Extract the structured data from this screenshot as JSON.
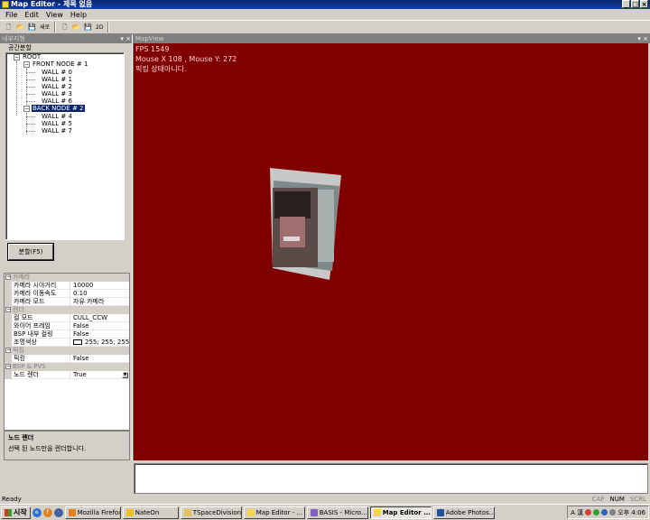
{
  "window": {
    "title": "Map Editor - 제목 없음",
    "controls": [
      "_",
      "□",
      "×"
    ]
  },
  "menu": [
    "File",
    "Edit",
    "View",
    "Help"
  ],
  "toolbar": {
    "label_a": "새로",
    "label_b": "2D"
  },
  "left_panel": {
    "title": "내부지형",
    "group_label": "공간분할",
    "tree": {
      "root": "ROOT",
      "front": "FRONT NODE # 1",
      "front_walls": [
        "WALL # 0",
        "WALL # 1",
        "WALL # 2",
        "WALL # 3",
        "WALL # 6"
      ],
      "back": "BACK NODE # 2",
      "back_walls": [
        "WALL # 4",
        "WALL # 5",
        "WALL # 7"
      ]
    },
    "split_button": "분할(F5)"
  },
  "properties": {
    "cat_camera": "카메라",
    "cam_far_k": "카메라 시야거리",
    "cam_far_v": "10000",
    "cam_speed_k": "카메라 이동속도",
    "cam_speed_v": "0.10",
    "cam_mode_k": "카메라 모드",
    "cam_mode_v": "자유 카메라",
    "cat_render": "렌더",
    "cull_k": "컬 모드",
    "cull_v": "CULL_CCW",
    "wire_k": "와이어 프레임",
    "wire_v": "False",
    "bspcull_k": "BSP 내부 컬링",
    "bspcull_v": "False",
    "light_k": "조명색상",
    "light_v": "255; 255; 255",
    "cat_pick": "픽킹",
    "pick_k": "픽킹",
    "pick_v": "False",
    "cat_bsp": "BSP & PVS",
    "noderender_k": "노드 렌더",
    "noderender_v": "True"
  },
  "description": {
    "title": "노드 렌더",
    "text": "선택 된 노드만을 렌더합니다."
  },
  "mapview": {
    "title": "MapView",
    "fps": "FPS 1549",
    "mouse": "Mouse X 108 , Mouse Y: 272",
    "pick_state": "픽킹 상태아니다."
  },
  "status": {
    "text": "Ready",
    "cap": "CAP",
    "num": "NUM",
    "scrl": "SCRL"
  },
  "taskbar": {
    "start": "시작",
    "buttons": [
      "Mozilla Firefox",
      "NateOn",
      "TSpaceDivision",
      "Map Editor - ...",
      "BASIS - Micro...",
      "Map Editor ...",
      "Adobe Photos..."
    ],
    "ime": "A 漢",
    "clock": "오후 4:06"
  },
  "colors": {
    "viewport": "#800000",
    "selection": "#0a246a"
  }
}
